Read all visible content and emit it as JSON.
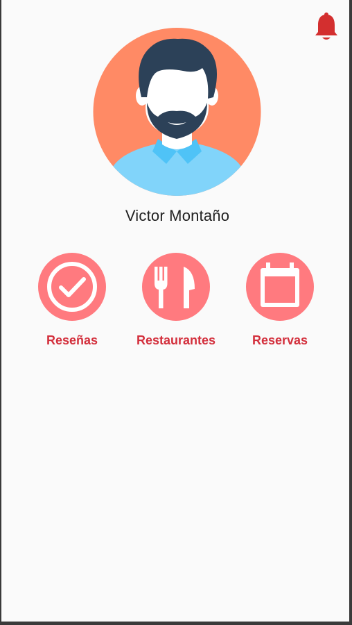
{
  "header": {
    "notification_icon": "bell-icon",
    "accent_color": "#d32f2f"
  },
  "profile": {
    "avatar_icon": "user-avatar-icon",
    "name": "Victor Montaño"
  },
  "menu": {
    "items": [
      {
        "label": "Reseñas",
        "icon": "check-circle-icon"
      },
      {
        "label": "Restaurantes",
        "icon": "fork-knife-icon"
      },
      {
        "label": "Reservas",
        "icon": "calendar-icon"
      }
    ],
    "circle_color": "#ff7a7f",
    "label_color": "#d32f3c"
  }
}
